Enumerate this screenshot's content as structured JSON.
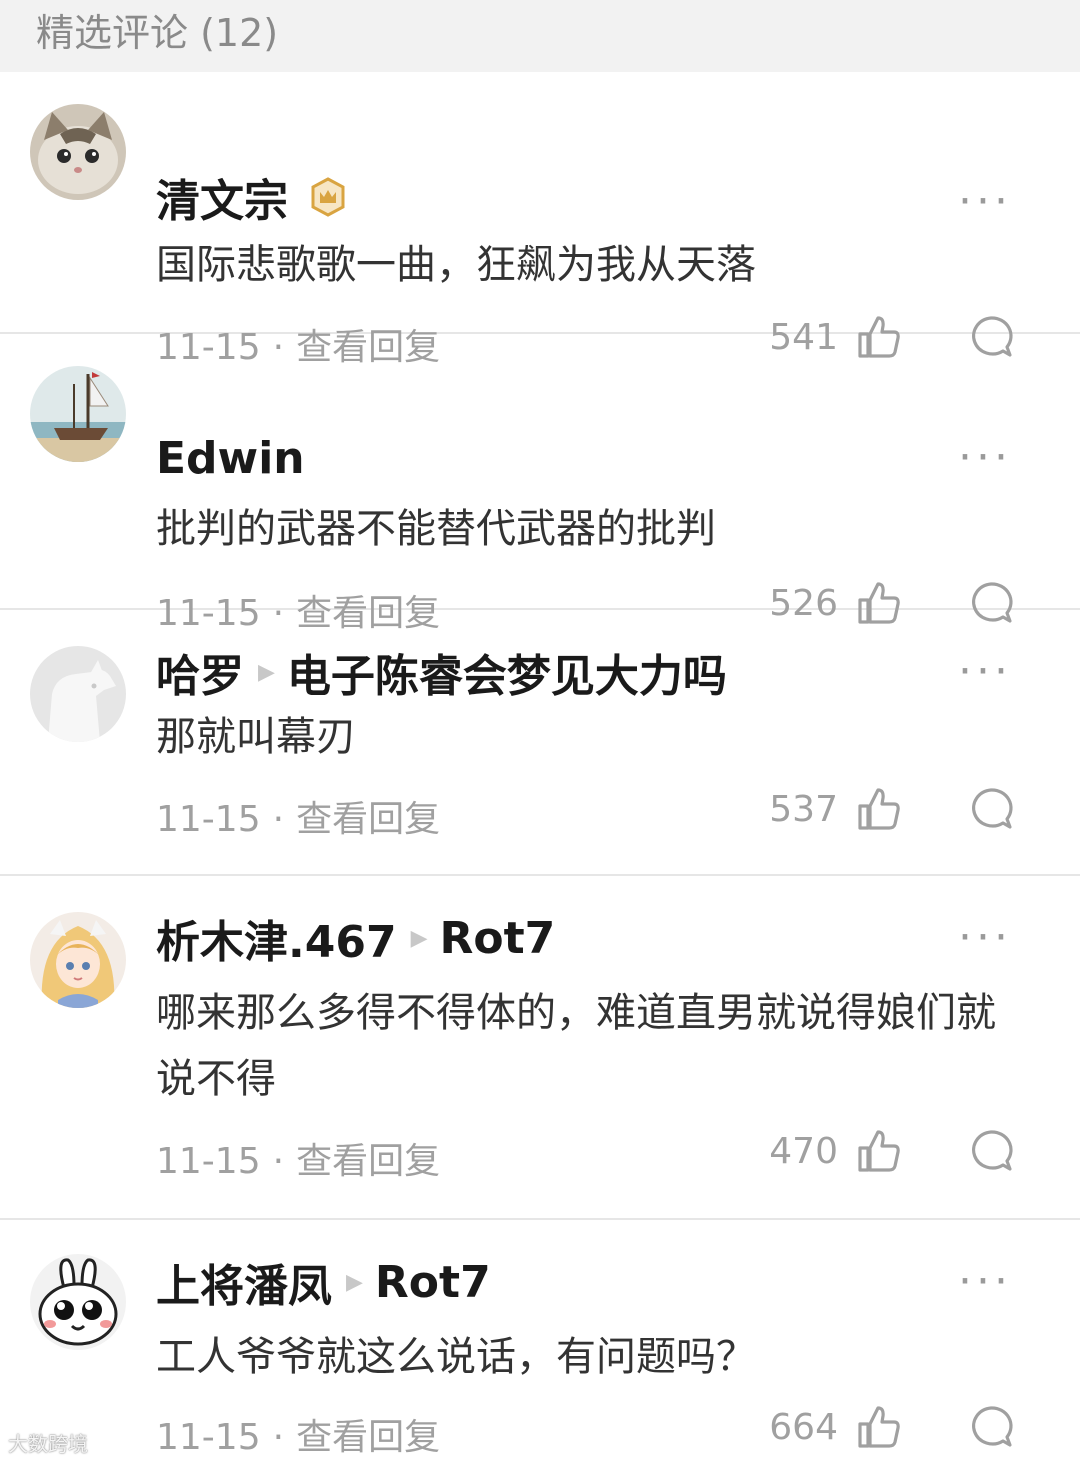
{
  "header": {
    "title": "精选评论 (12)"
  },
  "comments": [
    {
      "name": "清文宗",
      "has_badge": true,
      "reply_to": "",
      "content": "国际悲歌歌一曲，狂飙为我从天落",
      "date": "11-15",
      "view_replies": "查看回复",
      "likes": "541",
      "more": "···",
      "avatar": "cat-avatar"
    },
    {
      "name": "Edwin",
      "has_badge": false,
      "reply_to": "",
      "content": "批判的武器不能替代武器的批判",
      "date": "11-15",
      "view_replies": "查看回复",
      "likes": "526",
      "more": "···",
      "avatar": "boat-painting-avatar"
    },
    {
      "name": "哈罗",
      "has_badge": false,
      "reply_to": "电子陈睿会梦见大力吗",
      "content": "那就叫幕刃",
      "date": "11-15",
      "view_replies": "查看回复",
      "likes": "537",
      "more": "···",
      "avatar": "default-dog-avatar"
    },
    {
      "name": "析木津.467",
      "has_badge": false,
      "reply_to": "Rot7",
      "content": "哪来那么多得不得体的，难道直男就说得娘们就说不得",
      "date": "11-15",
      "view_replies": "查看回复",
      "likes": "470",
      "more": "···",
      "avatar": "anime-girl-avatar"
    },
    {
      "name": "上将潘凤",
      "has_badge": false,
      "reply_to": "Rot7",
      "content": "工人爷爷就这么说话，有问题吗？",
      "date": "11-15",
      "view_replies": "查看回复",
      "likes": "664",
      "more": "···",
      "avatar": "bunny-face-avatar"
    }
  ],
  "watermark": "大数跨境",
  "icons": {
    "like": "thumbs-up-icon",
    "reply": "speech-bubble-icon",
    "more": "more-dots-icon",
    "badge": "crown-badge-icon",
    "reply_arrow": "triangle-right-icon"
  },
  "colors": {
    "header_bg": "#f2f2f2",
    "text_primary": "#1a1a1a",
    "text_secondary": "#a0a0a0",
    "badge_gold": "#d9a441"
  }
}
